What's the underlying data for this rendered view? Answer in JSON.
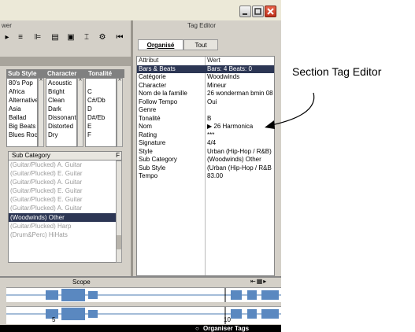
{
  "left_panel_title": "wer",
  "right_panel_title": "Tag Editor",
  "window_buttons": {
    "minimize": "minimize-icon",
    "maximize": "maximize-icon",
    "close": "close-icon"
  },
  "browser": {
    "columns": {
      "sub_style": {
        "header": "Sub Style",
        "items": [
          "80's Pop",
          "Africa",
          "Alternative",
          "Asia",
          "Ballad",
          "Big Beats",
          "Blues Roc"
        ]
      },
      "character": {
        "header": "Character",
        "items": [
          "Acoustic",
          "Bright",
          "Clean",
          "Dark",
          "Dissonant",
          "Distorted",
          "Dry"
        ]
      },
      "tonalite": {
        "header": "Tonalité",
        "items": [
          "",
          "C",
          "C#/Db",
          "D",
          "D#/Eb",
          "E",
          "F"
        ]
      }
    },
    "sub_category": {
      "header": "Sub Category",
      "header_right": "F",
      "items": [
        "(Guitar/Plucked) A. Guitar",
        "(Guitar/Plucked) E. Guitar",
        "(Guitar/Plucked) A. Guitar",
        "(Guitar/Plucked) E. Guitar",
        "(Guitar/Plucked) E. Guitar",
        "(Guitar/Plucked) A. Guitar",
        "(Woodwinds) Other",
        "(Guitar/Plucked) Harp",
        "(Drum&Perc) HiHats"
      ],
      "selected_index": 6
    }
  },
  "tag_editor": {
    "tabs": [
      "Organisé",
      "Tout"
    ],
    "active_tab": 0,
    "header": {
      "attribute": "Attribut",
      "value": "Wert"
    },
    "rows": [
      {
        "k": "Bars & Beats",
        "v": "Bars: 4 Beats: 0",
        "selected": true
      },
      {
        "k": "Catégorie",
        "v": "Woodwinds"
      },
      {
        "k": "Character",
        "v": "Mineur"
      },
      {
        "k": "Nom de la famille",
        "v": "26 wonderman bmin 08"
      },
      {
        "k": "Follow Tempo",
        "v": "Oui"
      },
      {
        "k": "Genre",
        "v": ""
      },
      {
        "k": "Tonalité",
        "v": "B"
      },
      {
        "k": "Nom",
        "v": "26 Harmonica"
      },
      {
        "k": "Rating",
        "v": "***"
      },
      {
        "k": "Signature",
        "v": "4/4"
      },
      {
        "k": "Style",
        "v": "Urban (Hip-Hop / R&B)"
      },
      {
        "k": "Sub Category",
        "v": "(Woodwinds) Other"
      },
      {
        "k": "Sub Style",
        "v": "(Urban (Hip-Hop / R&B"
      },
      {
        "k": "Tempo",
        "v": "83.00"
      }
    ]
  },
  "scope": {
    "label": "Scope",
    "ruler_marks": [
      "5",
      "10"
    ]
  },
  "status": {
    "label": "Organiser Tags"
  },
  "callout": {
    "text": "Section Tag Editor"
  },
  "colors": {
    "selection": "#2c3654",
    "panel": "#d4d0c8",
    "header": "#808080",
    "close": "#c0311b"
  }
}
